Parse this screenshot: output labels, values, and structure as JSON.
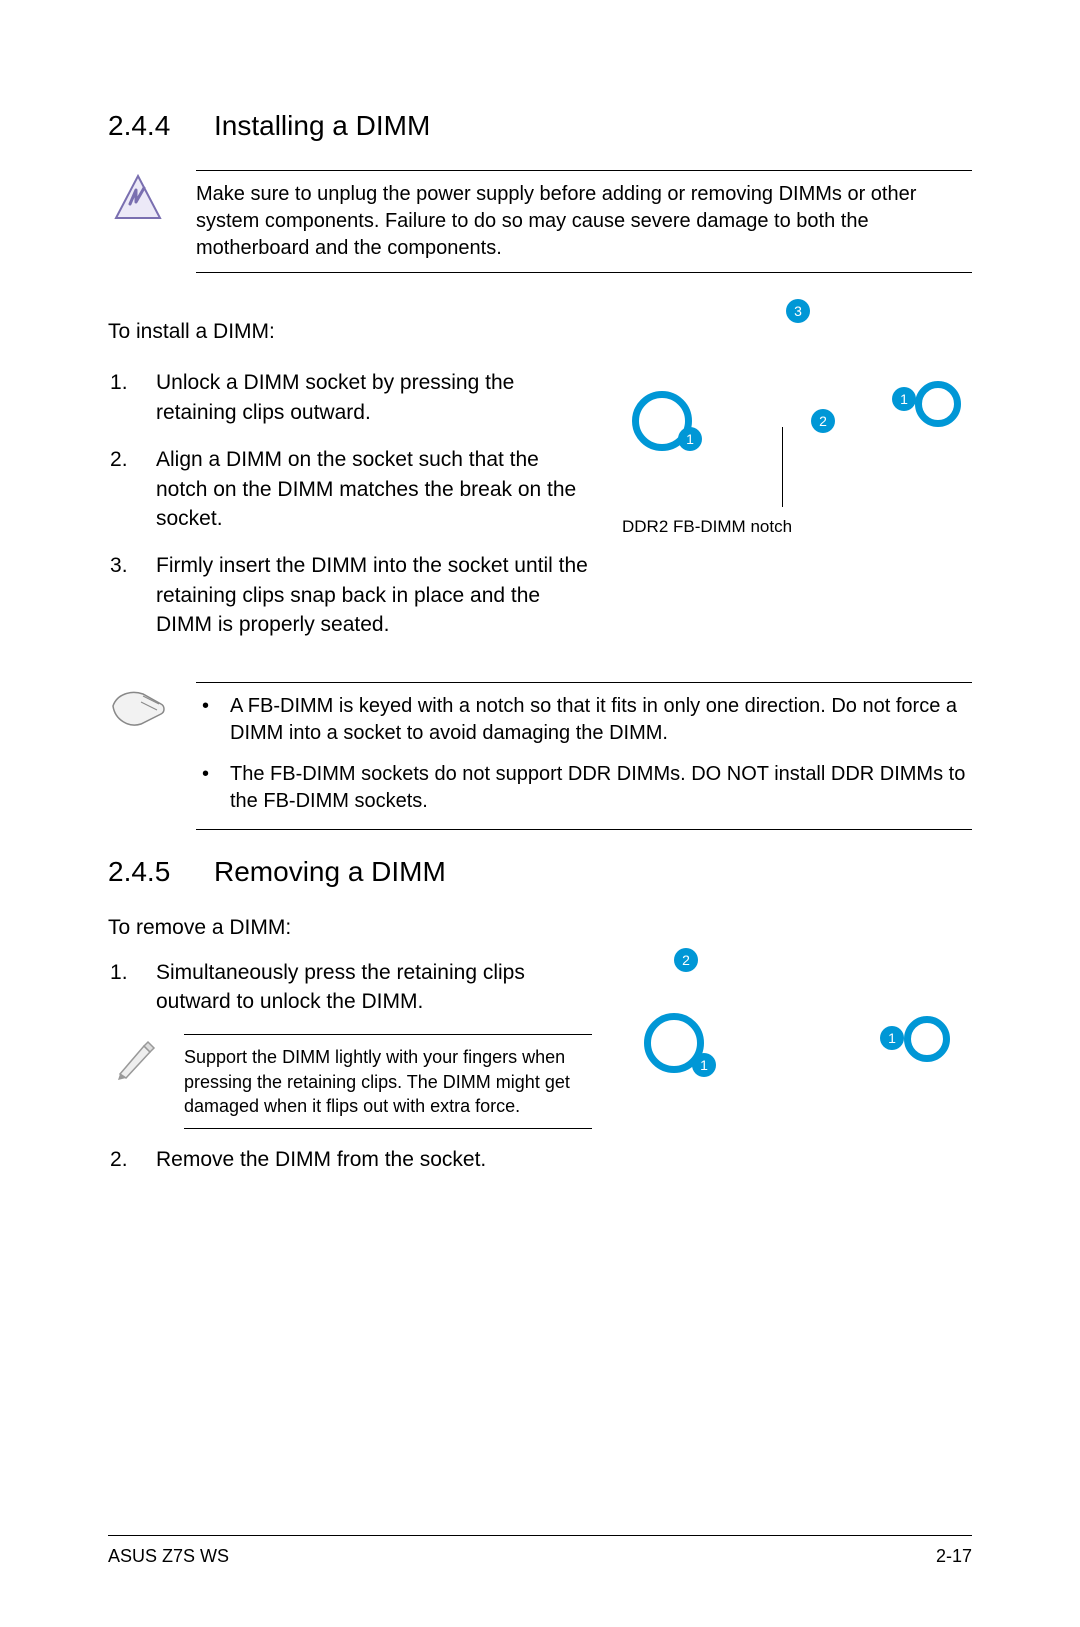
{
  "section1": {
    "number": "2.4.4",
    "title": "Installing a DIMM",
    "warning": "Make sure to unplug the power supply before adding or removing DIMMs or other system components. Failure to do so may cause severe damage to both the motherboard and the components.",
    "intro": "To install a DIMM:",
    "steps": [
      "Unlock a DIMM socket by pressing the retaining clips outward.",
      "Align a DIMM on the socket such that the notch on the DIMM matches the break on the socket.",
      "Firmly insert the DIMM into the socket until the retaining clips snap back in place and the DIMM is properly seated."
    ],
    "diagram_label": "DDR2 FB-DIMM notch",
    "diagram_numbers": {
      "a": "1",
      "b": "2",
      "c": "3",
      "d": "1"
    },
    "notes": [
      "A FB-DIMM is keyed with a notch so that it fits in only one direction. Do not force a DIMM into a socket to avoid damaging the DIMM.",
      "The FB-DIMM sockets do not support DDR DIMMs. DO NOT install DDR DIMMs to the FB-DIMM sockets."
    ]
  },
  "section2": {
    "number": "2.4.5",
    "title": "Removing a DIMM",
    "intro": "To remove a DIMM:",
    "steps": [
      "Simultaneously press the retaining clips outward to unlock the DIMM.",
      "Remove the DIMM from the socket."
    ],
    "note": "Support the DIMM lightly with your fingers when pressing the retaining clips. The DIMM might get damaged when it flips out with extra force.",
    "diagram_numbers": {
      "a": "1",
      "b": "2",
      "c": "1"
    }
  },
  "footer": {
    "left": "ASUS Z7S WS",
    "right": "2-17"
  }
}
